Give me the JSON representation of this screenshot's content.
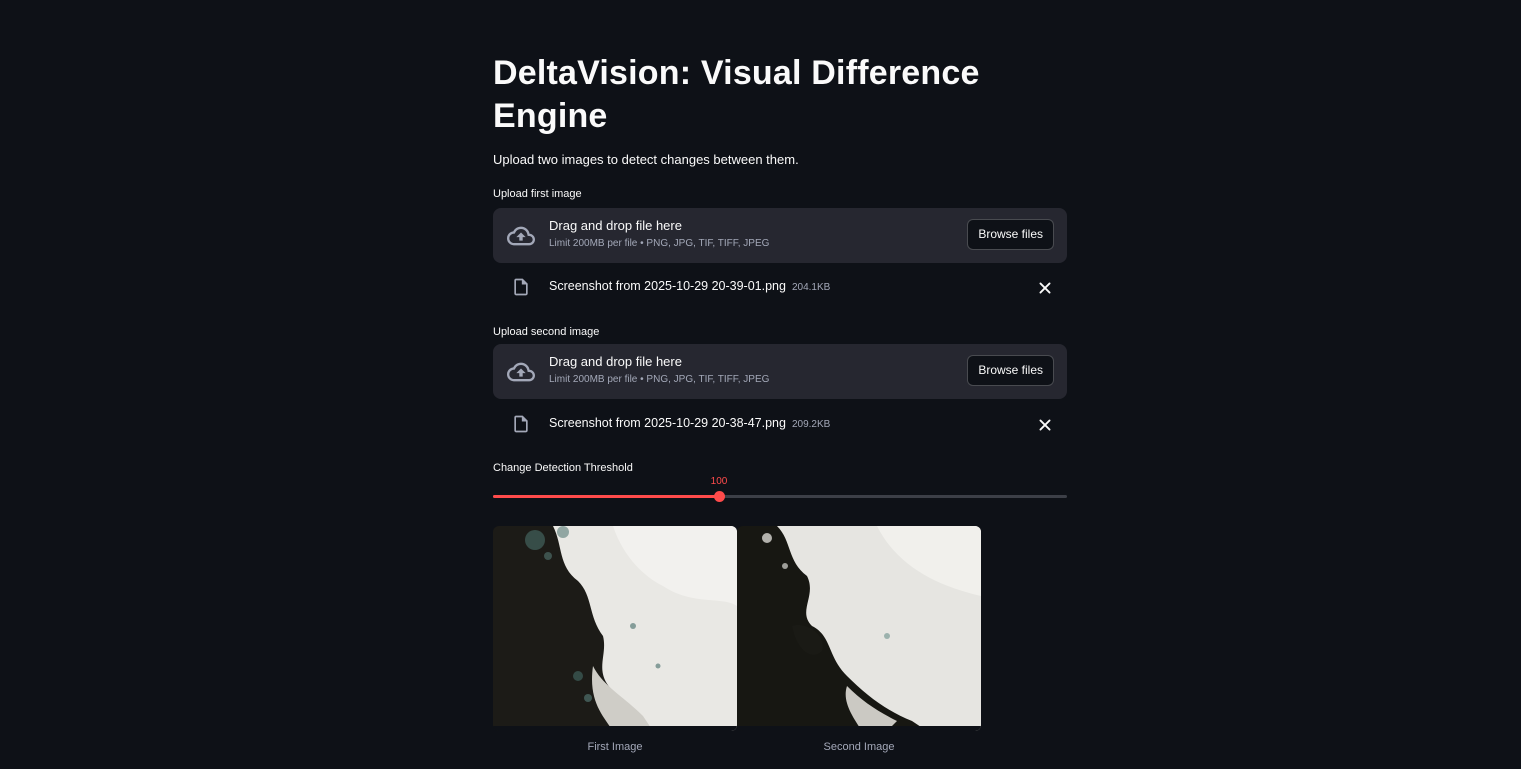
{
  "app": {
    "title": "DeltaVision: Visual Difference Engine",
    "description": "Upload two images to detect changes between them."
  },
  "uploaders": [
    {
      "label": "Upload first image",
      "drop_text": "Drag and drop file here",
      "limit_text": "Limit 200MB per file • PNG, JPG, TIF, TIFF, JPEG",
      "browse_label": "Browse files",
      "file": {
        "name": "Screenshot from 2025-10-29 20-39-01.png",
        "size": "204.1KB"
      }
    },
    {
      "label": "Upload second image",
      "drop_text": "Drag and drop file here",
      "limit_text": "Limit 200MB per file • PNG, JPG, TIF, TIFF, JPEG",
      "browse_label": "Browse files",
      "file": {
        "name": "Screenshot from 2025-10-29 20-38-47.png",
        "size": "209.2KB"
      }
    }
  ],
  "slider": {
    "label": "Change Detection Threshold",
    "value": "100",
    "fraction": 0.3931
  },
  "images": [
    {
      "caption": "First Image"
    },
    {
      "caption": "Second Image"
    }
  ],
  "colors": {
    "background": "#0e1117",
    "accent": "#ff4b4b",
    "surface": "#262730"
  },
  "icons": {
    "upload": "cloud-upload-icon",
    "file": "file-icon",
    "close": "close-icon"
  }
}
